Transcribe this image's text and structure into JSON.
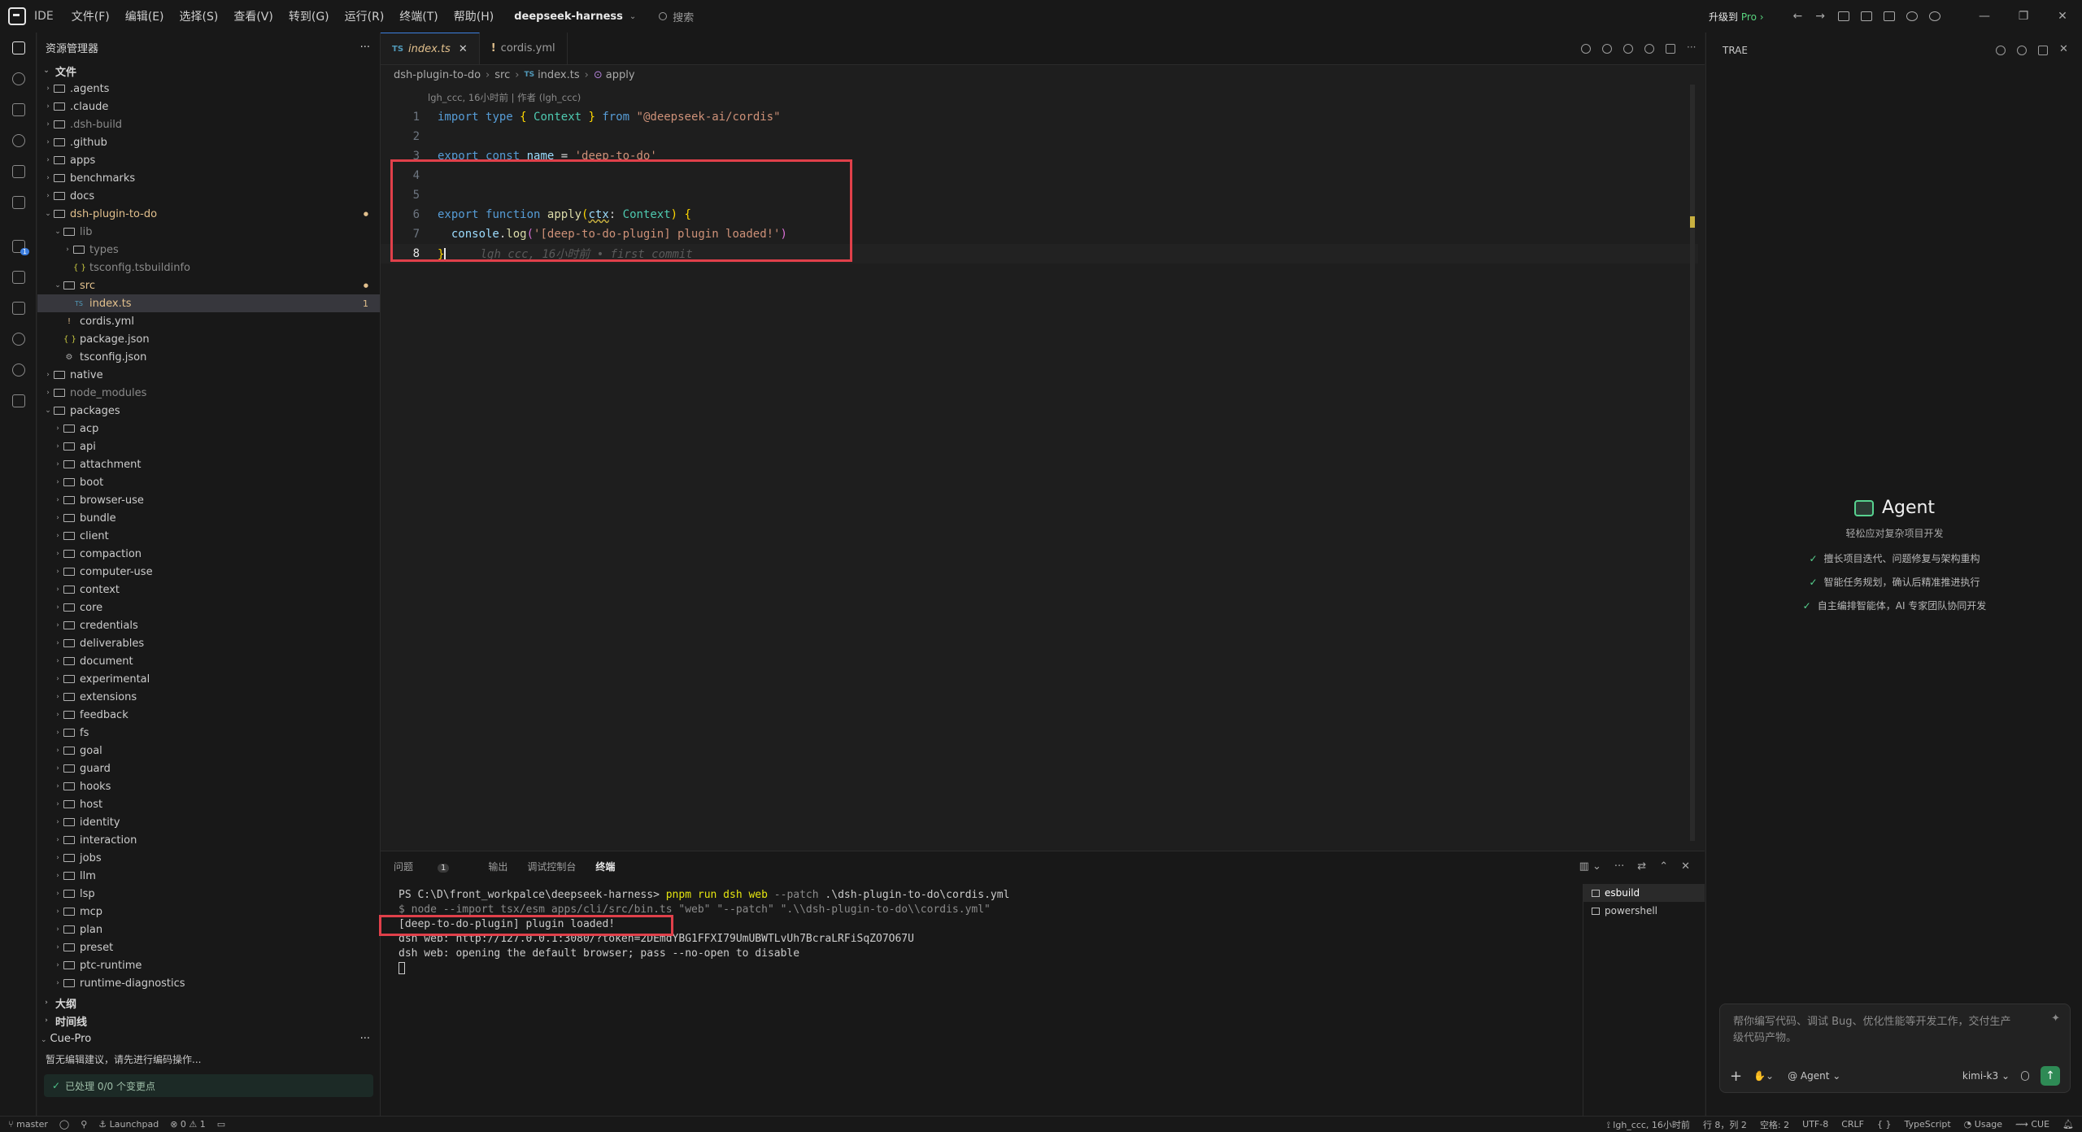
{
  "titlebar": {
    "app": "IDE",
    "menu": [
      "文件(F)",
      "编辑(E)",
      "选择(S)",
      "查看(V)",
      "转到(G)",
      "运行(R)",
      "终端(T)",
      "帮助(H)"
    ],
    "project": "deepseek-harness",
    "search_placeholder": "搜索",
    "upgrade_label": "升级到",
    "upgrade_pro": "Pro ›"
  },
  "sidebar": {
    "title": "资源管理器",
    "section_files": "文件",
    "tree": [
      {
        "name": ".agents",
        "depth": 0,
        "type": "folder"
      },
      {
        "name": ".claude",
        "depth": 0,
        "type": "folder"
      },
      {
        "name": ".dsh-build",
        "depth": 0,
        "type": "folder",
        "dim": true
      },
      {
        "name": ".github",
        "depth": 0,
        "type": "folder"
      },
      {
        "name": "apps",
        "depth": 0,
        "type": "folder"
      },
      {
        "name": "benchmarks",
        "depth": 0,
        "type": "folder"
      },
      {
        "name": "docs",
        "depth": 0,
        "type": "folder"
      },
      {
        "name": "dsh-plugin-to-do",
        "depth": 0,
        "type": "folder",
        "open": true,
        "modified": true
      },
      {
        "name": "lib",
        "depth": 1,
        "type": "folder",
        "open": true,
        "dim": true
      },
      {
        "name": "types",
        "depth": 2,
        "type": "folder",
        "dim": true
      },
      {
        "name": "tsconfig.tsbuildinfo",
        "depth": 2,
        "type": "json",
        "dim": true
      },
      {
        "name": "src",
        "depth": 1,
        "type": "folder",
        "open": true,
        "modified": true
      },
      {
        "name": "index.ts",
        "depth": 2,
        "type": "ts",
        "modified": true,
        "selected": true,
        "badge": "1"
      },
      {
        "name": "cordis.yml",
        "depth": 1,
        "type": "yml"
      },
      {
        "name": "package.json",
        "depth": 1,
        "type": "json"
      },
      {
        "name": "tsconfig.json",
        "depth": 1,
        "type": "cfg"
      },
      {
        "name": "native",
        "depth": 0,
        "type": "folder"
      },
      {
        "name": "node_modules",
        "depth": 0,
        "type": "folder",
        "dim": true
      },
      {
        "name": "packages",
        "depth": 0,
        "type": "folder",
        "open": true
      },
      {
        "name": "acp",
        "depth": 1,
        "type": "folder"
      },
      {
        "name": "api",
        "depth": 1,
        "type": "folder"
      },
      {
        "name": "attachment",
        "depth": 1,
        "type": "folder"
      },
      {
        "name": "boot",
        "depth": 1,
        "type": "folder"
      },
      {
        "name": "browser-use",
        "depth": 1,
        "type": "folder"
      },
      {
        "name": "bundle",
        "depth": 1,
        "type": "folder"
      },
      {
        "name": "client",
        "depth": 1,
        "type": "folder"
      },
      {
        "name": "compaction",
        "depth": 1,
        "type": "folder"
      },
      {
        "name": "computer-use",
        "depth": 1,
        "type": "folder"
      },
      {
        "name": "context",
        "depth": 1,
        "type": "folder"
      },
      {
        "name": "core",
        "depth": 1,
        "type": "folder"
      },
      {
        "name": "credentials",
        "depth": 1,
        "type": "folder"
      },
      {
        "name": "deliverables",
        "depth": 1,
        "type": "folder"
      },
      {
        "name": "document",
        "depth": 1,
        "type": "folder"
      },
      {
        "name": "experimental",
        "depth": 1,
        "type": "folder"
      },
      {
        "name": "extensions",
        "depth": 1,
        "type": "folder"
      },
      {
        "name": "feedback",
        "depth": 1,
        "type": "folder"
      },
      {
        "name": "fs",
        "depth": 1,
        "type": "folder"
      },
      {
        "name": "goal",
        "depth": 1,
        "type": "folder"
      },
      {
        "name": "guard",
        "depth": 1,
        "type": "folder"
      },
      {
        "name": "hooks",
        "depth": 1,
        "type": "folder"
      },
      {
        "name": "host",
        "depth": 1,
        "type": "folder"
      },
      {
        "name": "identity",
        "depth": 1,
        "type": "folder"
      },
      {
        "name": "interaction",
        "depth": 1,
        "type": "folder"
      },
      {
        "name": "jobs",
        "depth": 1,
        "type": "folder"
      },
      {
        "name": "llm",
        "depth": 1,
        "type": "folder"
      },
      {
        "name": "lsp",
        "depth": 1,
        "type": "folder"
      },
      {
        "name": "mcp",
        "depth": 1,
        "type": "folder"
      },
      {
        "name": "plan",
        "depth": 1,
        "type": "folder"
      },
      {
        "name": "preset",
        "depth": 1,
        "type": "folder"
      },
      {
        "name": "ptc-runtime",
        "depth": 1,
        "type": "folder"
      },
      {
        "name": "runtime-diagnostics",
        "depth": 1,
        "type": "folder"
      }
    ],
    "section_outline": "大纲",
    "section_timeline": "时间线",
    "cuepro_title": "Cue-Pro",
    "cuepro_hint": "暂无编辑建议，请先进行编码操作...",
    "cuepro_done": "已处理 0/0 个变更点"
  },
  "editor": {
    "tabs": [
      {
        "label": "index.ts",
        "kind": "TS",
        "active": true
      },
      {
        "label": "cordis.yml",
        "kind": "!",
        "active": false
      }
    ],
    "breadcrumb": [
      "dsh-plugin-to-do",
      "src",
      "index.ts",
      "apply"
    ],
    "blame_header": "lgh_ccc, 16小时前 | 作者 (lgh_ccc)",
    "inline_blame": "lgh_ccc, 16小时前 • first commit",
    "line_numbers": [
      "1",
      "2",
      "3",
      "4",
      "5",
      "6",
      "7",
      "8"
    ]
  },
  "panel": {
    "tabs": [
      "问题",
      "输出",
      "调试控制台",
      "终端"
    ],
    "problems_count": "1",
    "active_tab": "终端",
    "terminal_lines": [
      "PS C:\\D\\front_workpalce\\deepseek-harness> ",
      "$ node --import tsx/esm apps/cli/src/bin.ts \"web\" \"--patch\" \".\\\\dsh-plugin-to-do\\\\cordis.yml\"",
      "[deep-to-do-plugin] plugin loaded!",
      "dsh web: http://127.0.0.1:3080/?token=2DEmdYBG1FFXI79UmUBWTLvUh7BcraLRFiSqZO7O67U",
      "dsh web: opening the default browser; pass --no-open to disable"
    ],
    "prompt_cmd": "pnpm run dsh web",
    "prompt_flag": " --patch ",
    "prompt_path": ".\\dsh-plugin-to-do\\cordis.yml",
    "terminals": [
      "esbuild",
      "powershell"
    ]
  },
  "agent": {
    "header": "TRAE",
    "title": "Agent",
    "subtitle": "轻松应对复杂项目开发",
    "features": [
      "擅长项目迭代、问题修复与架构重构",
      "智能任务规划，确认后精准推进执行",
      "自主编排智能体，AI 专家团队协同开发"
    ],
    "input_placeholder": "帮你编写代码、调试 Bug、优化性能等开发工作，交付生产级代码产物。",
    "mode": "@ Agent",
    "model": "kimi-k3"
  },
  "statusbar": {
    "branch": "master",
    "launchpad": "Launchpad",
    "errors": "0",
    "warnings": "1",
    "blame": "lgh_ccc, 16小时前",
    "position": "行 8，列 2",
    "spaces": "空格: 2",
    "encoding": "UTF-8",
    "eol": "CRLF",
    "braces": "{ }",
    "language": "TypeScript",
    "usage": "Usage",
    "cue": "CUE"
  },
  "colors": {
    "highlight_box": "#e0404a",
    "accent": "#3d7fe0",
    "agent_green": "#57d28f"
  }
}
